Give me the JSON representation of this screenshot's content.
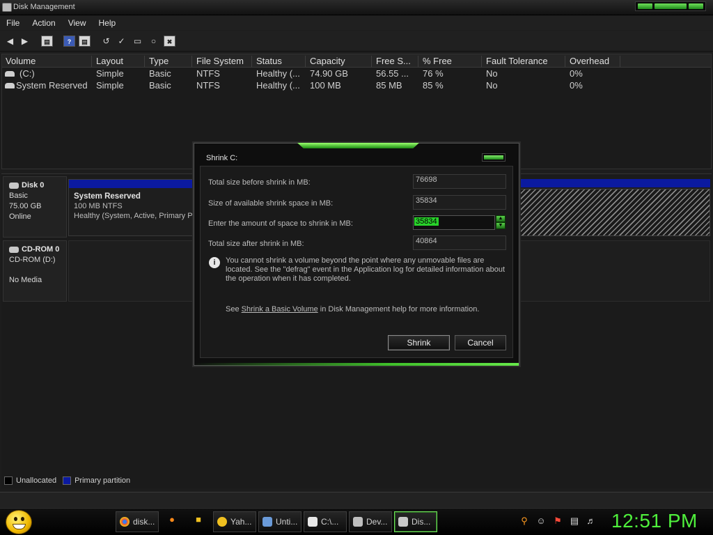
{
  "window": {
    "title": "Disk Management"
  },
  "menu": [
    "File",
    "Action",
    "View",
    "Help"
  ],
  "volume_table": {
    "headers": [
      "Volume",
      "Layout",
      "Type",
      "File System",
      "Status",
      "Capacity",
      "Free S...",
      "% Free",
      "Fault Tolerance",
      "Overhead"
    ],
    "rows": [
      [
        "(C:)",
        "Simple",
        "Basic",
        "NTFS",
        "Healthy (...",
        "74.90 GB",
        "56.55 ...",
        "76 %",
        "No",
        "0%"
      ],
      [
        "System Reserved",
        "Simple",
        "Basic",
        "NTFS",
        "Healthy (...",
        "100 MB",
        "85 MB",
        "85 %",
        "No",
        "0%"
      ]
    ]
  },
  "disks": [
    {
      "name": "Disk 0",
      "type": "Basic",
      "size": "75.00 GB",
      "status": "Online",
      "partition": {
        "name": "System Reserved",
        "size": "100 MB NTFS",
        "status": "Healthy (System, Active, Primary Pa"
      }
    },
    {
      "name": "CD-ROM 0",
      "type": "CD-ROM (D:)",
      "status": "No Media"
    }
  ],
  "legend": {
    "unallocated": "Unallocated",
    "primary": "Primary partition"
  },
  "dialog": {
    "title": "Shrink C:",
    "fields": [
      {
        "label": "Total size before shrink in MB:",
        "value": "76698"
      },
      {
        "label": "Size of available shrink space in MB:",
        "value": "35834"
      },
      {
        "label": "Enter the amount of space to shrink in MB:",
        "value": "35834"
      },
      {
        "label": "Total size after shrink in MB:",
        "value": "40864"
      }
    ],
    "info": "You cannot shrink a volume beyond the point where any unmovable files are located. See the \"defrag\" event in the Application log for detailed information about the operation when it has completed.",
    "help_prefix": "See ",
    "help_link": "Shrink a Basic Volume",
    "help_suffix": " in Disk Management help for more information.",
    "shrink_label": "Shrink",
    "cancel_label": "Cancel"
  },
  "taskbar": {
    "tasks": [
      "disk...",
      "Yah...",
      "Unti...",
      "C:\\...",
      "Dev...",
      "Dis..."
    ],
    "clock": "12:51 PM"
  },
  "colors": {
    "accent": "#4ff03c",
    "primary_partition": "#0b1aa0"
  }
}
